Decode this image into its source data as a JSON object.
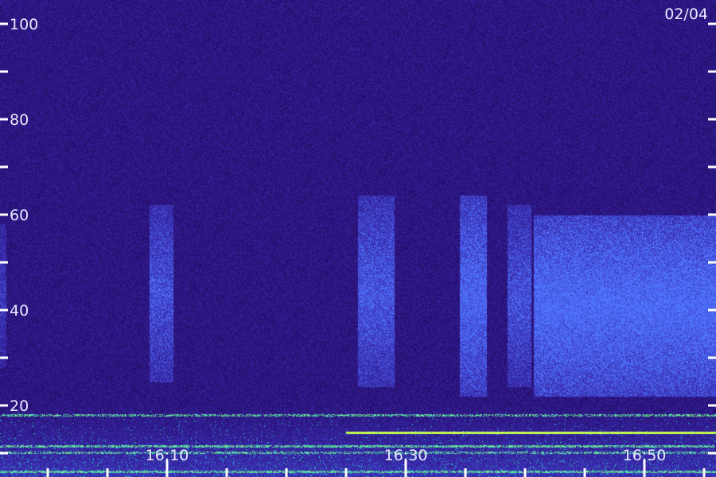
{
  "chart_data": {
    "type": "heatmap",
    "title": "",
    "annotation": "02/04",
    "xlabel": "",
    "ylabel": "",
    "x_tick_labels": [
      "16:10",
      "16:30",
      "16:50"
    ],
    "y_tick_labels": [
      "20",
      "40",
      "60",
      "80",
      "100"
    ],
    "y_ticks": [
      20,
      40,
      60,
      80,
      100
    ],
    "y_minor_ticks": [
      10,
      30,
      50,
      70,
      90
    ],
    "ylim": [
      5,
      105
    ],
    "x_start_minute": 16.0,
    "x_end_minute": 76.0,
    "x_tick_minutes": [
      30,
      50,
      70
    ],
    "x_minor_tick_every_minutes": 5,
    "grid": false,
    "colors": {
      "background": "#14083a",
      "noise_low": "#1a0a4a",
      "noise_high": "#3a2ad0",
      "band": "#3060ff",
      "low_band": "#40e0d0",
      "line": "#d0ff40",
      "ticks": "#ffffff"
    },
    "bright_bands": [
      {
        "x_start": 16.0,
        "x_end": 16.5,
        "y_low": 28,
        "y_high": 58,
        "intensity": 0.35
      },
      {
        "x_start": 28.5,
        "x_end": 30.5,
        "y_low": 25,
        "y_high": 62,
        "intensity": 0.55
      },
      {
        "x_start": 46.0,
        "x_end": 49.0,
        "y_low": 24,
        "y_high": 64,
        "intensity": 0.6
      },
      {
        "x_start": 54.5,
        "x_end": 56.8,
        "y_low": 22,
        "y_high": 64,
        "intensity": 0.75
      },
      {
        "x_start": 58.5,
        "x_end": 60.5,
        "y_low": 24,
        "y_high": 62,
        "intensity": 0.55
      },
      {
        "x_start": 60.7,
        "x_end": 76.0,
        "y_low": 22,
        "y_high": 60,
        "intensity": 0.85
      }
    ],
    "horizontal_lines": [
      {
        "y": 11.5,
        "x_start": 16.0,
        "x_end": 76.0,
        "intensity": 0.7
      },
      {
        "y": 10.2,
        "x_start": 16.0,
        "x_end": 76.0,
        "intensity": 0.5
      },
      {
        "y": 6.2,
        "x_start": 16.0,
        "x_end": 76.0,
        "intensity": 0.65
      },
      {
        "y": 14.3,
        "x_start": 45.0,
        "x_end": 76.0,
        "intensity": 1.0
      },
      {
        "y": 18.0,
        "x_start": 16.0,
        "x_end": 76.0,
        "intensity": 0.55
      }
    ]
  }
}
